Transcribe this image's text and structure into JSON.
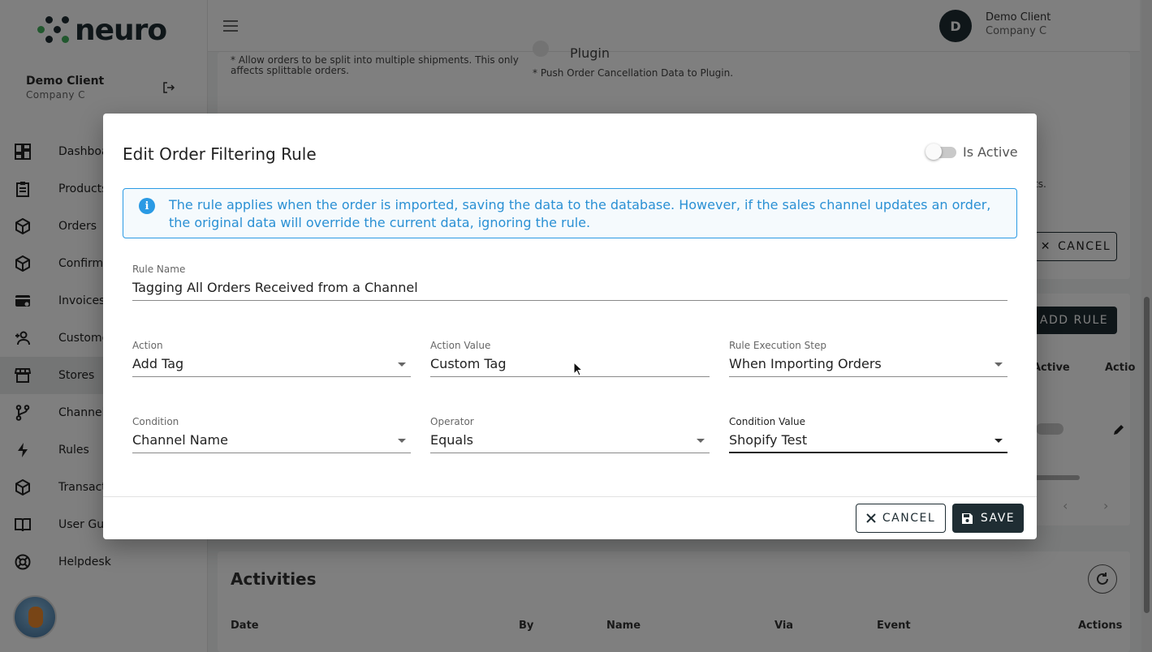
{
  "brand": {
    "logo_text": "neuro"
  },
  "sidebar": {
    "user_name": "Demo Client",
    "company": "Company C",
    "items": [
      {
        "label": "Dashboard",
        "icon": "dashboard-icon"
      },
      {
        "label": "Products",
        "icon": "clipboard-icon"
      },
      {
        "label": "Orders",
        "icon": "box-icon"
      },
      {
        "label": "Confirmations",
        "icon": "box-icon"
      },
      {
        "label": "Invoices",
        "icon": "credit-card-icon"
      },
      {
        "label": "Customers",
        "icon": "add-user-icon"
      },
      {
        "label": "Stores",
        "icon": "store-icon"
      },
      {
        "label": "Channels",
        "icon": "branch-icon"
      },
      {
        "label": "Rules",
        "icon": "bolt-icon"
      },
      {
        "label": "Transactions",
        "icon": "box-icon"
      },
      {
        "label": "User Guide",
        "icon": "book-icon"
      },
      {
        "label": "Helpdesk",
        "icon": "lifebuoy-icon"
      }
    ],
    "active_item": "Stores"
  },
  "topbar": {
    "avatar_initial": "D",
    "user_name": "Demo Client",
    "company": "Company C"
  },
  "background": {
    "split_note": "* Allow orders to be split into multiple shipments. This only affects splittable orders.",
    "plugin_label": "Plugin",
    "push_note": "* Push Order Cancellation Data to Plugin.",
    "trailing_note": "ts.",
    "cancel_label": "CANCEL",
    "add_rule_label": "ADD RULE",
    "col_active": "Active",
    "col_actions": "Actio",
    "activities_title": "Activities",
    "activities_columns": [
      "Date",
      "By",
      "Name",
      "Via",
      "Event",
      "Actions"
    ]
  },
  "modal": {
    "title": "Edit Order Filtering Rule",
    "is_active_label": "Is Active",
    "is_active": false,
    "info_text": "The rule applies when the order is imported, saving the data to the database. However, if the sales channel updates an order, the original data will override the current data, ignoring the rule.",
    "fields": {
      "rule_name": {
        "label": "Rule Name",
        "value": "Tagging All Orders Received from a Channel"
      },
      "action": {
        "label": "Action",
        "value": "Add Tag"
      },
      "action_value": {
        "label": "Action Value",
        "value": "Custom Tag"
      },
      "execution_step": {
        "label": "Rule Execution Step",
        "value": "When Importing Orders"
      },
      "condition": {
        "label": "Condition",
        "value": "Channel Name"
      },
      "operator": {
        "label": "Operator",
        "value": "Equals"
      },
      "condition_value": {
        "label": "Condition Value",
        "value": "Shopify Test"
      }
    },
    "cancel_label": "CANCEL",
    "save_label": "SAVE"
  },
  "colors": {
    "primary": "#1f2d33",
    "brand_green": "#43b05c",
    "info_blue": "#2a9ae4"
  }
}
